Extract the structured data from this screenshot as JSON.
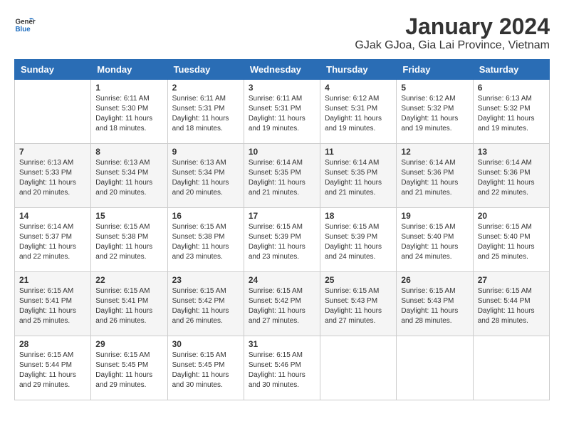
{
  "header": {
    "logo_line1": "General",
    "logo_line2": "Blue",
    "title": "January 2024",
    "subtitle": "GJak GJoa, Gia Lai Province, Vietnam"
  },
  "days_of_week": [
    "Sunday",
    "Monday",
    "Tuesday",
    "Wednesday",
    "Thursday",
    "Friday",
    "Saturday"
  ],
  "weeks": [
    [
      {
        "day": "",
        "info": ""
      },
      {
        "day": "1",
        "info": "Sunrise: 6:11 AM\nSunset: 5:30 PM\nDaylight: 11 hours\nand 18 minutes."
      },
      {
        "day": "2",
        "info": "Sunrise: 6:11 AM\nSunset: 5:31 PM\nDaylight: 11 hours\nand 18 minutes."
      },
      {
        "day": "3",
        "info": "Sunrise: 6:11 AM\nSunset: 5:31 PM\nDaylight: 11 hours\nand 19 minutes."
      },
      {
        "day": "4",
        "info": "Sunrise: 6:12 AM\nSunset: 5:31 PM\nDaylight: 11 hours\nand 19 minutes."
      },
      {
        "day": "5",
        "info": "Sunrise: 6:12 AM\nSunset: 5:32 PM\nDaylight: 11 hours\nand 19 minutes."
      },
      {
        "day": "6",
        "info": "Sunrise: 6:13 AM\nSunset: 5:32 PM\nDaylight: 11 hours\nand 19 minutes."
      }
    ],
    [
      {
        "day": "7",
        "info": "Sunrise: 6:13 AM\nSunset: 5:33 PM\nDaylight: 11 hours\nand 20 minutes."
      },
      {
        "day": "8",
        "info": "Sunrise: 6:13 AM\nSunset: 5:34 PM\nDaylight: 11 hours\nand 20 minutes."
      },
      {
        "day": "9",
        "info": "Sunrise: 6:13 AM\nSunset: 5:34 PM\nDaylight: 11 hours\nand 20 minutes."
      },
      {
        "day": "10",
        "info": "Sunrise: 6:14 AM\nSunset: 5:35 PM\nDaylight: 11 hours\nand 21 minutes."
      },
      {
        "day": "11",
        "info": "Sunrise: 6:14 AM\nSunset: 5:35 PM\nDaylight: 11 hours\nand 21 minutes."
      },
      {
        "day": "12",
        "info": "Sunrise: 6:14 AM\nSunset: 5:36 PM\nDaylight: 11 hours\nand 21 minutes."
      },
      {
        "day": "13",
        "info": "Sunrise: 6:14 AM\nSunset: 5:36 PM\nDaylight: 11 hours\nand 22 minutes."
      }
    ],
    [
      {
        "day": "14",
        "info": "Sunrise: 6:14 AM\nSunset: 5:37 PM\nDaylight: 11 hours\nand 22 minutes."
      },
      {
        "day": "15",
        "info": "Sunrise: 6:15 AM\nSunset: 5:38 PM\nDaylight: 11 hours\nand 22 minutes."
      },
      {
        "day": "16",
        "info": "Sunrise: 6:15 AM\nSunset: 5:38 PM\nDaylight: 11 hours\nand 23 minutes."
      },
      {
        "day": "17",
        "info": "Sunrise: 6:15 AM\nSunset: 5:39 PM\nDaylight: 11 hours\nand 23 minutes."
      },
      {
        "day": "18",
        "info": "Sunrise: 6:15 AM\nSunset: 5:39 PM\nDaylight: 11 hours\nand 24 minutes."
      },
      {
        "day": "19",
        "info": "Sunrise: 6:15 AM\nSunset: 5:40 PM\nDaylight: 11 hours\nand 24 minutes."
      },
      {
        "day": "20",
        "info": "Sunrise: 6:15 AM\nSunset: 5:40 PM\nDaylight: 11 hours\nand 25 minutes."
      }
    ],
    [
      {
        "day": "21",
        "info": "Sunrise: 6:15 AM\nSunset: 5:41 PM\nDaylight: 11 hours\nand 25 minutes."
      },
      {
        "day": "22",
        "info": "Sunrise: 6:15 AM\nSunset: 5:41 PM\nDaylight: 11 hours\nand 26 minutes."
      },
      {
        "day": "23",
        "info": "Sunrise: 6:15 AM\nSunset: 5:42 PM\nDaylight: 11 hours\nand 26 minutes."
      },
      {
        "day": "24",
        "info": "Sunrise: 6:15 AM\nSunset: 5:42 PM\nDaylight: 11 hours\nand 27 minutes."
      },
      {
        "day": "25",
        "info": "Sunrise: 6:15 AM\nSunset: 5:43 PM\nDaylight: 11 hours\nand 27 minutes."
      },
      {
        "day": "26",
        "info": "Sunrise: 6:15 AM\nSunset: 5:43 PM\nDaylight: 11 hours\nand 28 minutes."
      },
      {
        "day": "27",
        "info": "Sunrise: 6:15 AM\nSunset: 5:44 PM\nDaylight: 11 hours\nand 28 minutes."
      }
    ],
    [
      {
        "day": "28",
        "info": "Sunrise: 6:15 AM\nSunset: 5:44 PM\nDaylight: 11 hours\nand 29 minutes."
      },
      {
        "day": "29",
        "info": "Sunrise: 6:15 AM\nSunset: 5:45 PM\nDaylight: 11 hours\nand 29 minutes."
      },
      {
        "day": "30",
        "info": "Sunrise: 6:15 AM\nSunset: 5:45 PM\nDaylight: 11 hours\nand 30 minutes."
      },
      {
        "day": "31",
        "info": "Sunrise: 6:15 AM\nSunset: 5:46 PM\nDaylight: 11 hours\nand 30 minutes."
      },
      {
        "day": "",
        "info": ""
      },
      {
        "day": "",
        "info": ""
      },
      {
        "day": "",
        "info": ""
      }
    ]
  ]
}
